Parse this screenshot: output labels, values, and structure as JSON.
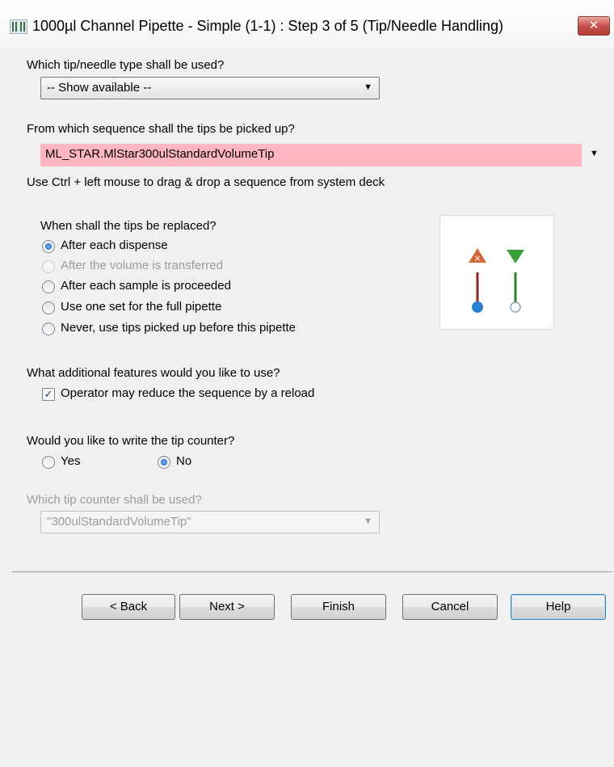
{
  "window": {
    "title": "1000µl Channel Pipette - Simple (1-1) : Step 3 of 5 (Tip/Needle Handling)",
    "close_glyph": "✕"
  },
  "tip_type": {
    "question": "Which tip/needle type shall be used?",
    "selected": "-- Show available --"
  },
  "sequence": {
    "question": "From which sequence shall the tips be picked up?",
    "value": "ML_STAR.MlStar300ulStandardVolumeTip",
    "value_bg_color": "#ffb6c1",
    "hint": "Use Ctrl + left mouse to drag & drop a sequence from system deck"
  },
  "replace": {
    "question": "When shall the tips be replaced?",
    "options": [
      {
        "label": "After each dispense",
        "selected": true,
        "enabled": true
      },
      {
        "label": "After the volume is transferred",
        "selected": false,
        "enabled": false
      },
      {
        "label": "After each sample is proceeded",
        "selected": false,
        "enabled": true
      },
      {
        "label": "Use one set for the full pipette",
        "selected": false,
        "enabled": true
      },
      {
        "label": "Never, use tips picked up before this pipette",
        "selected": false,
        "enabled": true
      }
    ],
    "illustration_icons": [
      "tip-eject-icon",
      "tip-pickup-icon"
    ]
  },
  "features": {
    "question": "What additional features would you like to use?",
    "reload_label": "Operator may reduce the sequence by a reload",
    "reload_checked": true
  },
  "tip_counter": {
    "question": "Would you like to write the tip counter?",
    "yes_label": "Yes",
    "no_label": "No",
    "selected": "No",
    "which_question": "Which tip counter shall be used?",
    "which_value": "\"300ulStandardVolumeTip\"",
    "which_enabled": false
  },
  "buttons": {
    "back": "< Back",
    "next": "Next >",
    "finish": "Finish",
    "cancel": "Cancel",
    "help": "Help"
  }
}
